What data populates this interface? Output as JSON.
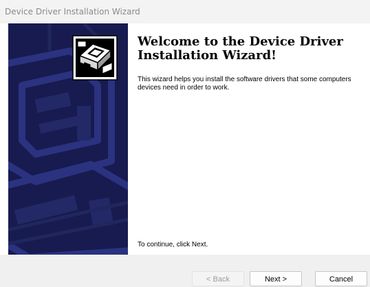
{
  "window": {
    "title": "Device Driver Installation Wizard"
  },
  "main": {
    "heading": "Welcome to the Device Driver Installation Wizard!",
    "description": "This wizard helps you install the software drivers that some computers devices need in order to work.",
    "continue_text": "To continue, click Next."
  },
  "buttons": {
    "back_label": "< Back",
    "next_label": "Next >",
    "cancel_label": "Cancel"
  },
  "icons": {
    "wizard": "computer-install-icon",
    "banner": "hardware-silhouette"
  },
  "colors": {
    "side_panel": "#171b4f",
    "footer": "#f0f0f0"
  }
}
